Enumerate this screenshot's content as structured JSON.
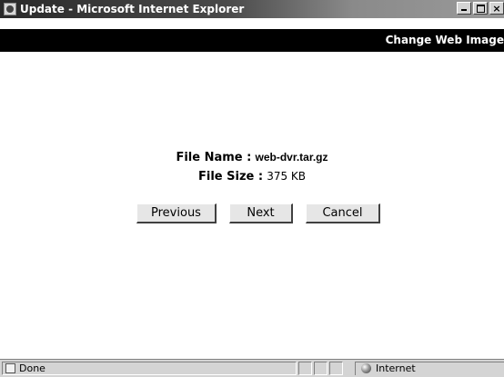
{
  "window": {
    "title": "Update - Microsoft Internet Explorer",
    "close_glyph": "×"
  },
  "header": {
    "title": "Change Web Image"
  },
  "file_info": {
    "name_label": "File Name :",
    "name_value": "web-dvr.tar.gz",
    "size_label": "File Size :",
    "size_value": "375 KB"
  },
  "buttons": {
    "previous": "Previous",
    "next": "Next",
    "cancel": "Cancel"
  },
  "statusbar": {
    "status": "Done",
    "zone": "Internet"
  },
  "icons": {
    "window": "ie-page-icon",
    "status": "page-icon",
    "zone": "globe-icon"
  }
}
